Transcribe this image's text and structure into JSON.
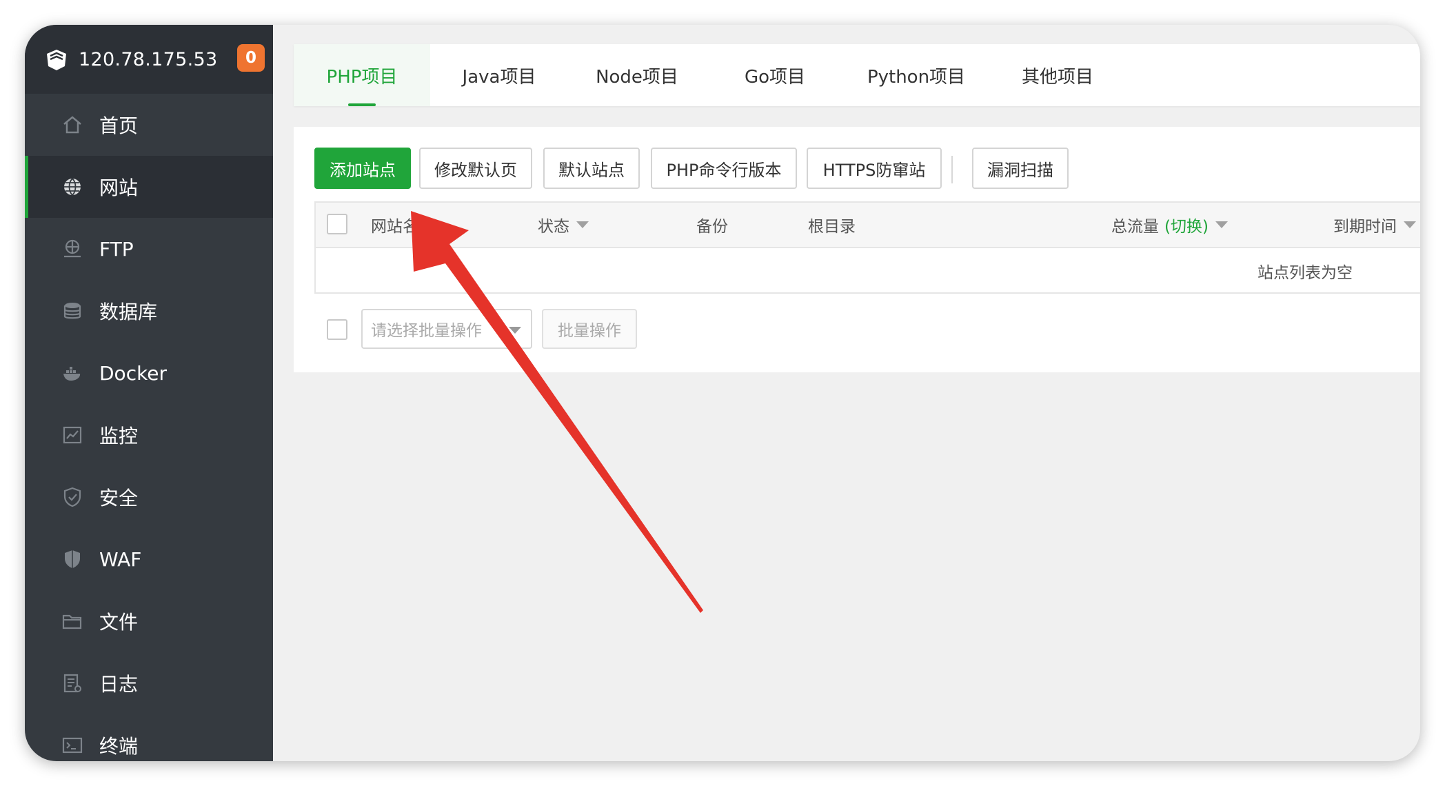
{
  "sidebar": {
    "server_ip": "120.78.175.53",
    "badge_count": "0",
    "items": [
      {
        "label": "首页",
        "icon": "home-icon"
      },
      {
        "label": "网站",
        "icon": "globe-icon",
        "active": true
      },
      {
        "label": "FTP",
        "icon": "ftp-icon"
      },
      {
        "label": "数据库",
        "icon": "database-icon"
      },
      {
        "label": "Docker",
        "icon": "docker-icon"
      },
      {
        "label": "监控",
        "icon": "monitor-icon"
      },
      {
        "label": "安全",
        "icon": "shield-icon"
      },
      {
        "label": "WAF",
        "icon": "waf-icon"
      },
      {
        "label": "文件",
        "icon": "folder-icon"
      },
      {
        "label": "日志",
        "icon": "log-icon"
      },
      {
        "label": "终端",
        "icon": "terminal-icon"
      }
    ]
  },
  "tabs": [
    "PHP项目",
    "Java项目",
    "Node项目",
    "Go项目",
    "Python项目",
    "其他项目"
  ],
  "toolbar": {
    "add_site": "添加站点",
    "edit_default_page": "修改默认页",
    "default_site": "默认站点",
    "php_cli_version": "PHP命令行版本",
    "https_guard": "HTTPS防窜站",
    "vuln_scan": "漏洞扫描"
  },
  "table": {
    "columns": {
      "site_name": "网站名",
      "status": "状态",
      "backup": "备份",
      "root_dir": "根目录",
      "total_traffic": "总流量",
      "traffic_toggle": "(切换)",
      "expire_time": "到期时间"
    },
    "empty_text": "站点列表为空"
  },
  "batch": {
    "select_placeholder": "请选择批量操作",
    "button": "批量操作"
  },
  "colors": {
    "accent": "#20a53a",
    "sidebar_bg": "#353a40",
    "badge": "#ef7430",
    "annotation_arrow": "#e5332a"
  }
}
